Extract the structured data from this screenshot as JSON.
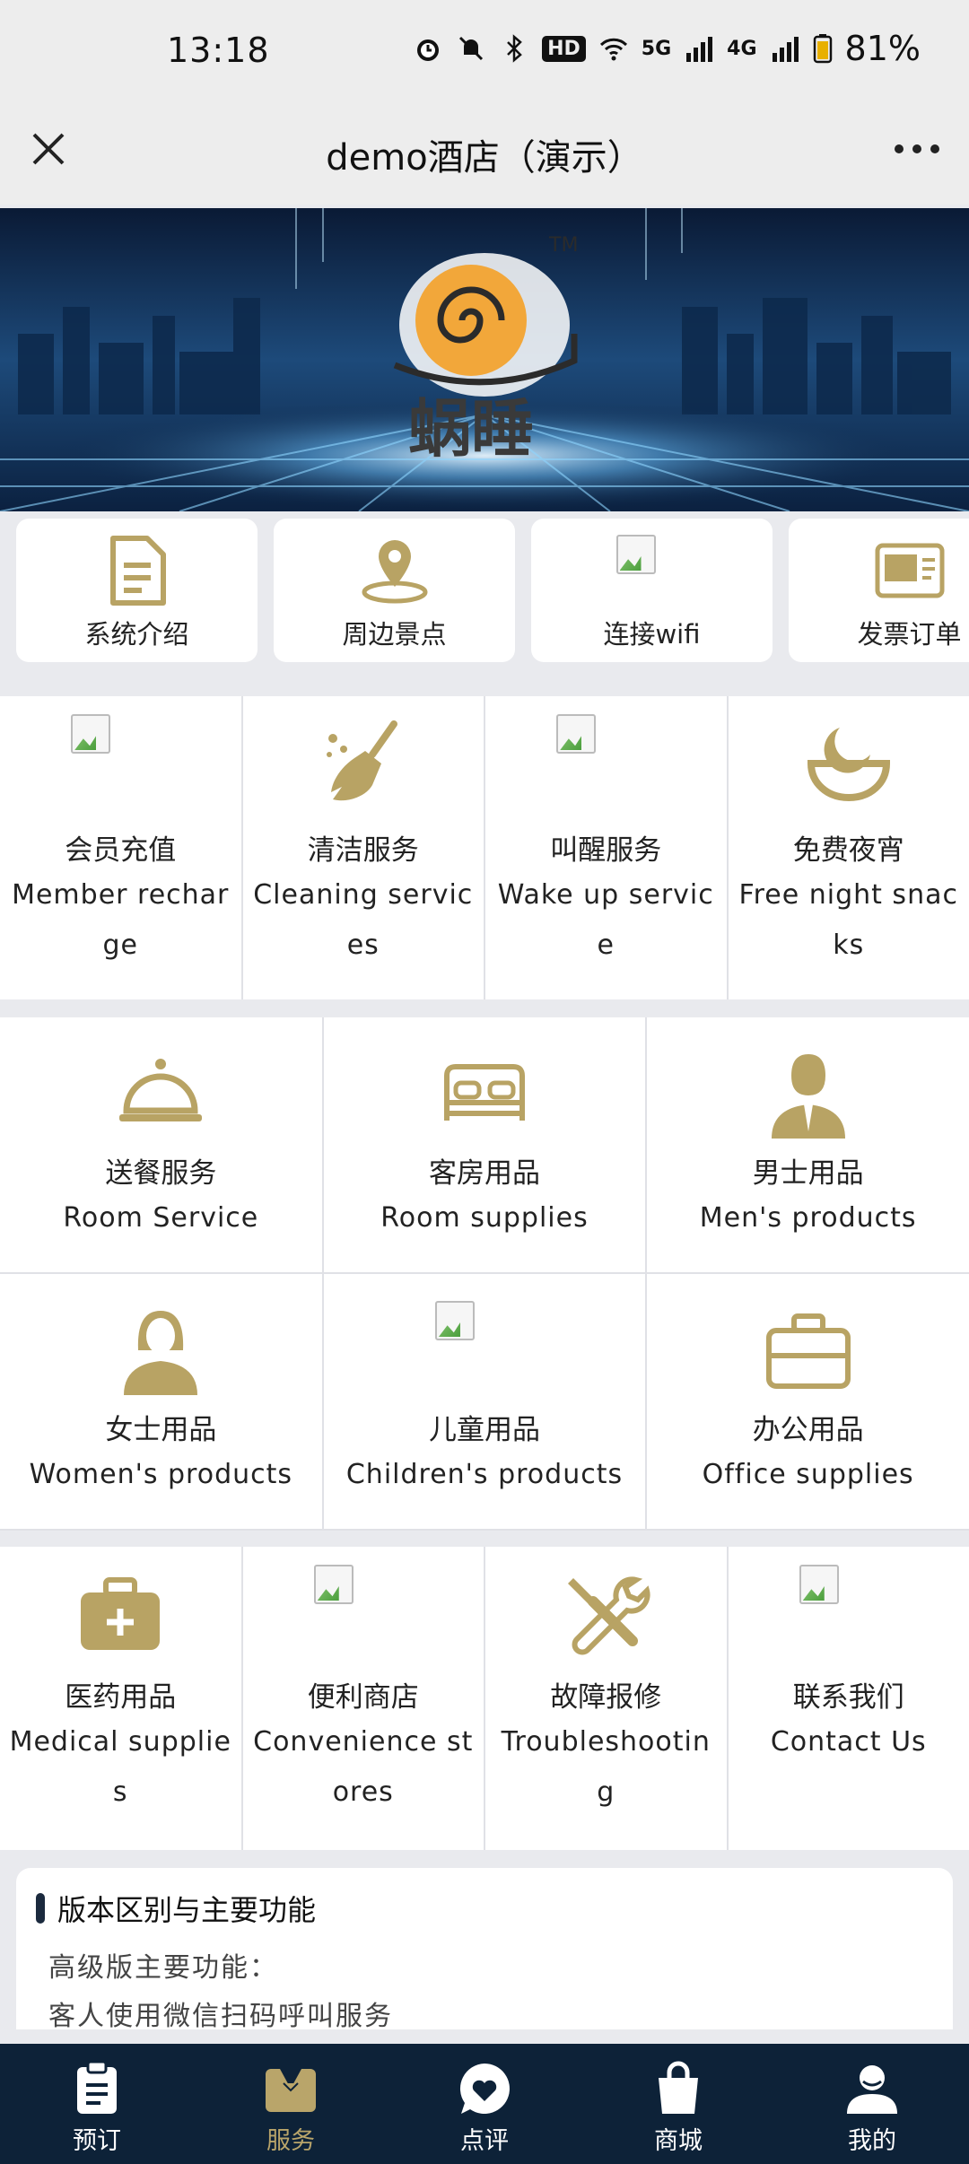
{
  "status": {
    "time": "13:18",
    "battery": "81%",
    "network1": "5G",
    "network2": "4G",
    "hd": "HD"
  },
  "header": {
    "title": "demo酒店（演示）"
  },
  "banner": {
    "brand": "蜗睡",
    "tm": "TM"
  },
  "quick_row": [
    {
      "label": "系统介绍",
      "icon": "document-icon"
    },
    {
      "label": "周边景点",
      "icon": "location-pin-icon"
    },
    {
      "label": "连接wifi",
      "icon": "broken-image-icon"
    },
    {
      "label": "发票订单",
      "icon": "invoice-icon"
    }
  ],
  "section1": [
    {
      "zh": "会员充值",
      "en": "Member recharge",
      "icon": "broken-image-icon"
    },
    {
      "zh": "清洁服务",
      "en": "Cleaning services",
      "icon": "broom-icon"
    },
    {
      "zh": "叫醒服务",
      "en": "Wake up service",
      "icon": "broken-image-icon"
    },
    {
      "zh": "免费夜宵",
      "en": "Free night snacks",
      "icon": "moon-bowl-icon"
    }
  ],
  "section2": [
    {
      "zh": "送餐服务",
      "en": "Room Service",
      "icon": "cloche-icon"
    },
    {
      "zh": "客房用品",
      "en": "Room supplies",
      "icon": "bed-icon"
    },
    {
      "zh": "男士用品",
      "en": "Men's products",
      "icon": "man-icon"
    },
    {
      "zh": "女士用品",
      "en": "Women's products",
      "icon": "woman-icon"
    },
    {
      "zh": "儿童用品",
      "en": "Children's products",
      "icon": "broken-image-icon"
    },
    {
      "zh": "办公用品",
      "en": "Office supplies",
      "icon": "briefcase-icon"
    }
  ],
  "section3": [
    {
      "zh": "医药用品",
      "en": "Medical supplies",
      "icon": "medical-kit-icon"
    },
    {
      "zh": "便利商店",
      "en": "Convenience stores",
      "icon": "broken-image-icon"
    },
    {
      "zh": "故障报修",
      "en": "Troubleshooting",
      "icon": "tools-icon"
    },
    {
      "zh": "联系我们",
      "en": "Contact Us",
      "icon": "broken-image-icon"
    }
  ],
  "info": {
    "heading": "版本区别与主要功能",
    "line1": "高级版主要功能：",
    "line2": "客人使用微信扫码呼叫服务"
  },
  "tabs": [
    {
      "label": "预订",
      "icon": "clipboard-icon",
      "active": false
    },
    {
      "label": "服务",
      "icon": "butler-icon",
      "active": true
    },
    {
      "label": "点评",
      "icon": "heart-chat-icon",
      "active": false
    },
    {
      "label": "商城",
      "icon": "shopping-bag-icon",
      "active": false
    },
    {
      "label": "我的",
      "icon": "user-icon",
      "active": false
    }
  ],
  "colors": {
    "accent": "#b9a56a",
    "tabbar": "#0d2238",
    "gold_icon": "#b8a364"
  }
}
